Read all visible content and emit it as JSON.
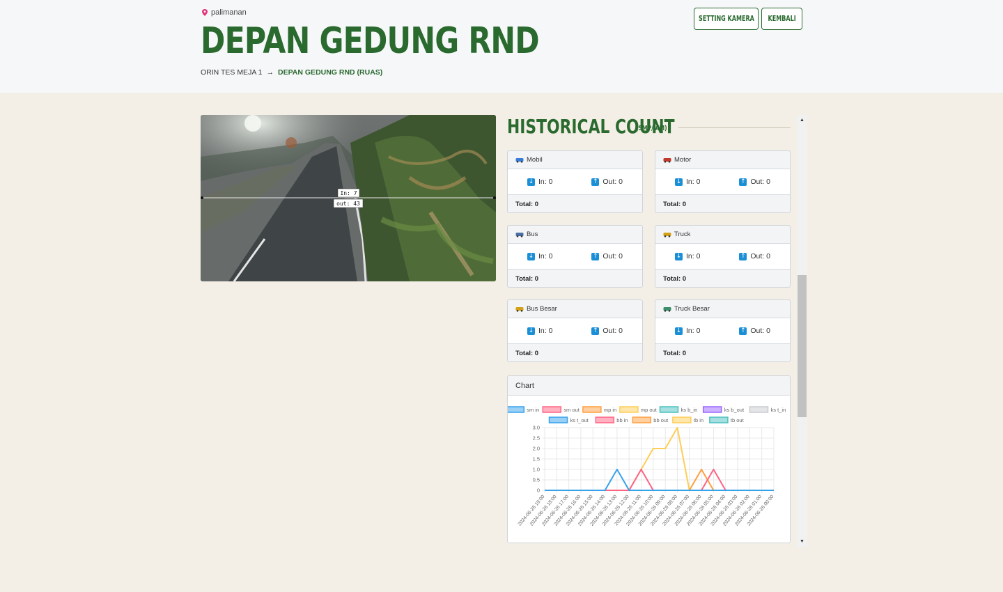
{
  "header": {
    "location": "palimanan",
    "title": "DEPAN GEDUNG RND",
    "breadcrumb_parent": "ORIN TES MEJA 1",
    "breadcrumb_sep": "→",
    "breadcrumb_current": "DEPAN GEDUNG RND (RUAS)",
    "setting_button": "SETTING KAMERA",
    "back_button": "KEMBALI"
  },
  "camera": {
    "in_label": "In:  7",
    "out_label": "out:  43"
  },
  "historical": {
    "title": "HISTORICAL COUNT",
    "unit": "(SMP/JAM)"
  },
  "cards": [
    {
      "name": "Mobil",
      "icon": "car-icon",
      "in": "In: 0",
      "out": "Out: 0",
      "total": "Total: 0"
    },
    {
      "name": "Motor",
      "icon": "motorcycle-icon",
      "in": "In: 0",
      "out": "Out: 0",
      "total": "Total: 0"
    },
    {
      "name": "Bus",
      "icon": "bus-icon",
      "in": "In: 0",
      "out": "Out: 0",
      "total": "Total: 0"
    },
    {
      "name": "Truck",
      "icon": "truck-icon",
      "in": "In: 0",
      "out": "Out: 0",
      "total": "Total: 0"
    },
    {
      "name": "Bus Besar",
      "icon": "big-bus-icon",
      "in": "In: 0",
      "out": "Out: 0",
      "total": "Total: 0"
    },
    {
      "name": "Truck Besar",
      "icon": "big-truck-icon",
      "in": "In: 0",
      "out": "Out: 0",
      "total": "Total: 0"
    }
  ],
  "chart_title": "Chart",
  "colors": {
    "brand": "#2a6a2f",
    "info": "#1a8fd6"
  },
  "chart_data": {
    "type": "line",
    "x": [
      "2024-06-26 19:00",
      "2024-06-26 18:00",
      "2024-06-26 17:00",
      "2024-06-26 16:00",
      "2024-06-26 15:00",
      "2024-06-26 14:00",
      "2024-06-26 13:00",
      "2024-06-26 12:00",
      "2024-06-26 11:00",
      "2024-06-26 10:00",
      "2024-06-26 09:00",
      "2024-06-26 08:00",
      "2024-06-26 07:00",
      "2024-06-26 06:00",
      "2024-06-26 05:00",
      "2024-06-26 04:00",
      "2024-06-26 03:00",
      "2024-06-26 02:00",
      "2024-06-26 01:00",
      "2024-06-26 00:00"
    ],
    "ylim": [
      0,
      3.0
    ],
    "yticks": [
      "3.0",
      "2.5",
      "2.0",
      "1.5",
      "1.0",
      "0.5",
      "0"
    ],
    "grid": true,
    "legend_position": "top",
    "series": [
      {
        "name": "sm in",
        "color": "#36a2eb",
        "values": [
          0,
          0,
          0,
          0,
          0,
          0,
          1,
          0,
          0,
          0,
          0,
          0,
          0,
          0,
          0,
          0,
          0,
          0,
          0,
          0
        ]
      },
      {
        "name": "sm out",
        "color": "#ff6384",
        "values": [
          0,
          0,
          0,
          0,
          0,
          0,
          0,
          0,
          1,
          0,
          0,
          0,
          0,
          0,
          1,
          0,
          0,
          0,
          0,
          0
        ]
      },
      {
        "name": "mp in",
        "color": "#ff9f40",
        "values": [
          0,
          0,
          0,
          0,
          0,
          0,
          0,
          0,
          0,
          0,
          0,
          0,
          0,
          1,
          0,
          0,
          0,
          0,
          0,
          0
        ]
      },
      {
        "name": "mp out",
        "color": "#ffcd56",
        "values": [
          0,
          0,
          0,
          0,
          0,
          0,
          0,
          0,
          1,
          2,
          2,
          3,
          0,
          0,
          0,
          0,
          0,
          0,
          0,
          0
        ]
      },
      {
        "name": "ks b_in",
        "color": "#4bc0c0",
        "values": [
          0,
          0,
          0,
          0,
          0,
          0,
          0,
          0,
          0,
          0,
          0,
          0,
          0,
          0,
          0,
          0,
          0,
          0,
          0,
          0
        ]
      },
      {
        "name": "ks b_out",
        "color": "#9966ff",
        "values": [
          0,
          0,
          0,
          0,
          0,
          0,
          0,
          0,
          0,
          0,
          0,
          0,
          0,
          0,
          0,
          0,
          0,
          0,
          0,
          0
        ]
      },
      {
        "name": "ks t_in",
        "color": "#c9cbcf",
        "values": [
          0,
          0,
          0,
          0,
          0,
          0,
          0,
          0,
          0,
          0,
          0,
          0,
          0,
          0,
          0,
          0,
          0,
          0,
          0,
          0
        ]
      },
      {
        "name": "ks t_out",
        "color": "#36a2eb",
        "values": [
          0,
          0,
          0,
          0,
          0,
          0,
          0,
          0,
          0,
          0,
          0,
          0,
          0,
          0,
          0,
          0,
          0,
          0,
          0,
          0
        ]
      },
      {
        "name": "bb in",
        "color": "#ff6384",
        "values": [
          0,
          0,
          0,
          0,
          0,
          0,
          0,
          0,
          0,
          0,
          0,
          0,
          0,
          0,
          0,
          0,
          0,
          0,
          0,
          0
        ]
      },
      {
        "name": "bb out",
        "color": "#ff9f40",
        "values": [
          0,
          0,
          0,
          0,
          0,
          0,
          0,
          0,
          0,
          0,
          0,
          0,
          0,
          0,
          0,
          0,
          0,
          0,
          0,
          0
        ]
      },
      {
        "name": "tb in",
        "color": "#ffcd56",
        "values": [
          0,
          0,
          0,
          0,
          0,
          0,
          0,
          0,
          0,
          0,
          0,
          0,
          0,
          0,
          0,
          0,
          0,
          0,
          0,
          0
        ]
      },
      {
        "name": "tb out",
        "color": "#4bc0c0",
        "values": [
          0,
          0,
          0,
          0,
          0,
          0,
          0,
          0,
          0,
          0,
          0,
          0,
          0,
          0,
          0,
          0,
          0,
          0,
          0,
          0
        ]
      }
    ]
  }
}
